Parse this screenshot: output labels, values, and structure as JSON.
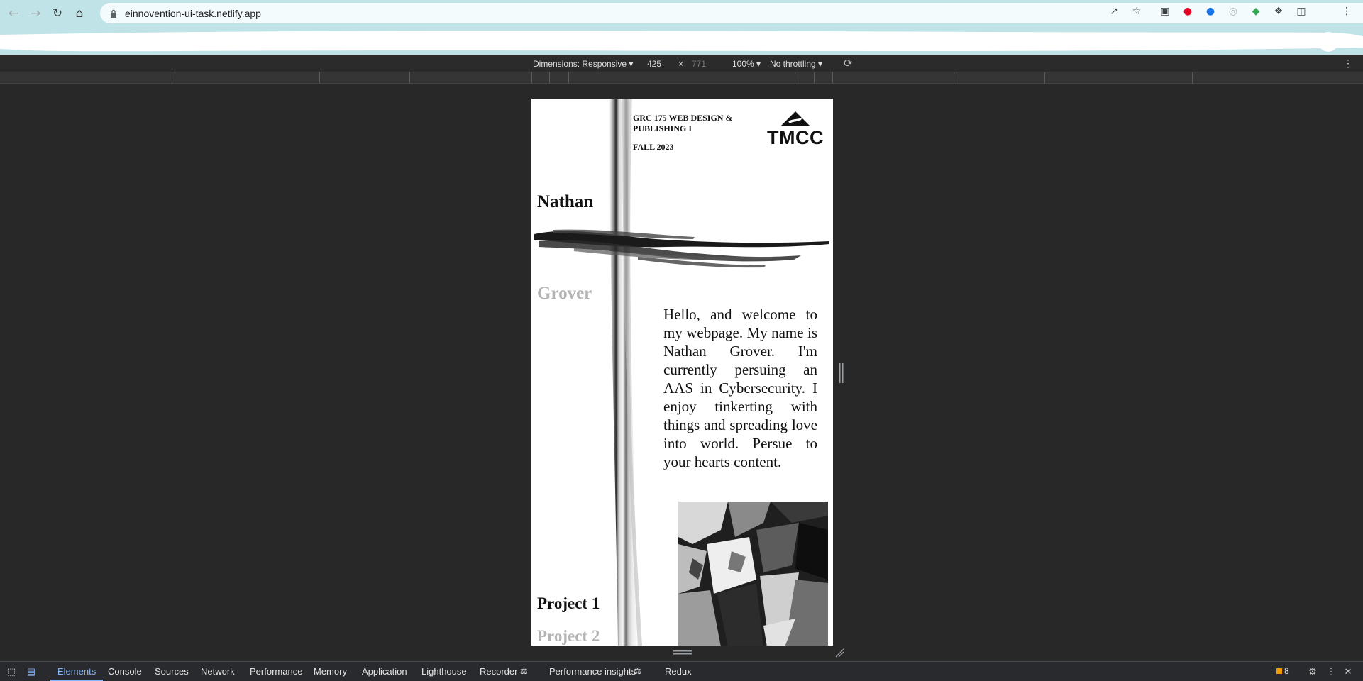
{
  "browser": {
    "url": "einnovention-ui-task.netlify.app"
  },
  "device_toolbar": {
    "dimensions_label": "Dimensions: Responsive",
    "width": "425",
    "times": "×",
    "height": "771",
    "zoom": "100%",
    "throttling": "No throttling",
    "caret": "▾"
  },
  "page": {
    "course": "GRC 175 WEB DESIGN & PUBLISHING I",
    "term": "FALL 2023",
    "logo_text": "TMCC",
    "first_name": "Nathan",
    "last_name": "Grover",
    "intro": "Hello, and welcome to my webpage. My name is Nathan Grover. I'm currently persuing an AAS in Cybersecurity. I enjoy tinkerting with things and spreading love into world. Persue to your hearts content.",
    "project1": "Project 1",
    "project2": "Project 2"
  },
  "devtools_tabs": [
    "Elements",
    "Console",
    "Sources",
    "Network",
    "Performance",
    "Memory",
    "Application",
    "Lighthouse",
    "Recorder",
    "Performance insights",
    "Redux"
  ],
  "issues_count": "8",
  "colors": {
    "chrome_bg": "#bfe3e7",
    "devtools_bg": "#282828",
    "active_tab": "#8ab4f8"
  }
}
